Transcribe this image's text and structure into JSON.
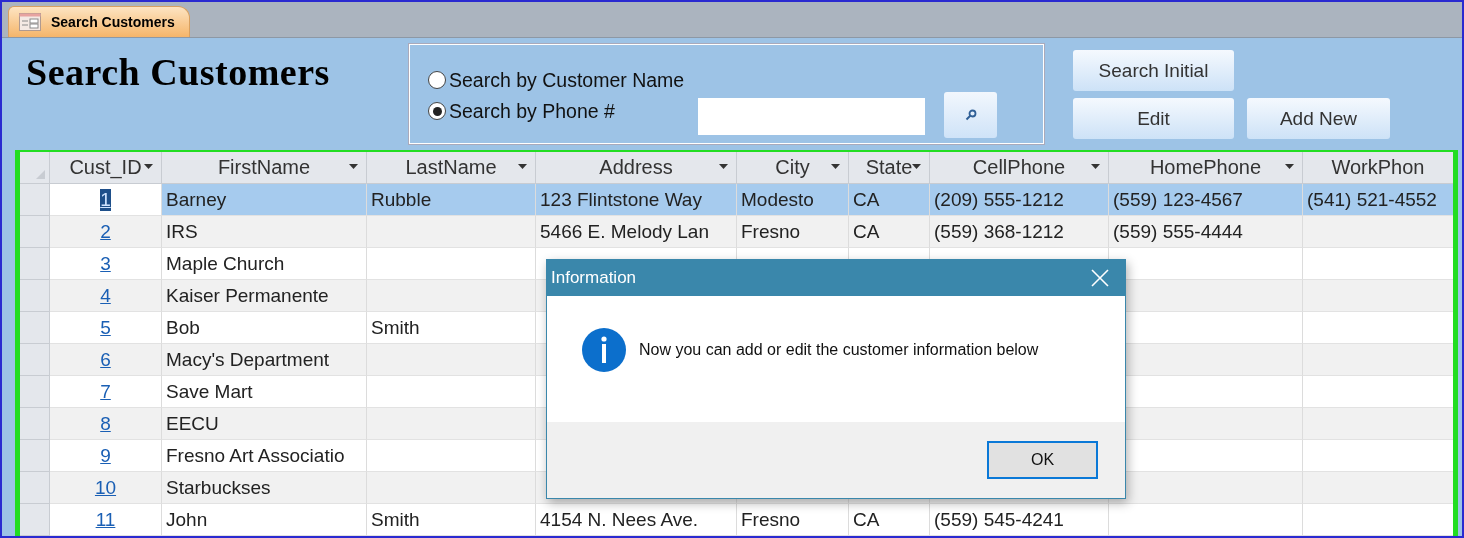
{
  "tab": {
    "label": "Search Customers"
  },
  "form": {
    "title": "Search Customers",
    "search_options": [
      {
        "label": "Search by Customer Name",
        "selected": false
      },
      {
        "label": "Search by Phone #",
        "selected": true
      }
    ],
    "buttons": [
      "Search Initial",
      "Edit",
      "Add New"
    ]
  },
  "table": {
    "columns": [
      {
        "label": "Cust_ID",
        "filter": true
      },
      {
        "label": "FirstName",
        "filter": true
      },
      {
        "label": "LastName",
        "filter": true
      },
      {
        "label": "Address",
        "filter": true
      },
      {
        "label": "City",
        "filter": true
      },
      {
        "label": "State",
        "filter": true
      },
      {
        "label": "CellPhone",
        "filter": true
      },
      {
        "label": "HomePhone",
        "filter": true
      },
      {
        "label": "WorkPhon",
        "filter": false
      }
    ],
    "rows": [
      {
        "selected": true,
        "cells": [
          "1",
          "Barney",
          "Rubble",
          "123 Flintstone Way",
          "Modesto",
          "CA",
          "(209) 555-1212",
          "(559) 123-4567",
          "(541) 521-4552"
        ]
      },
      {
        "selected": false,
        "cells": [
          "2",
          "IRS",
          null,
          "5466 E. Melody Lan",
          "Fresno",
          "CA",
          "(559) 368-1212",
          "(559) 555-4444",
          null
        ]
      },
      {
        "selected": false,
        "cells": [
          "3",
          "Maple Church",
          null,
          null,
          null,
          null,
          null,
          null,
          null
        ]
      },
      {
        "selected": false,
        "cells": [
          "4",
          "Kaiser Permanente",
          null,
          null,
          null,
          null,
          null,
          null,
          null
        ]
      },
      {
        "selected": false,
        "cells": [
          "5",
          "Bob",
          "Smith",
          null,
          null,
          null,
          null,
          null,
          null
        ]
      },
      {
        "selected": false,
        "cells": [
          "6",
          "Macy's Department",
          null,
          null,
          null,
          null,
          null,
          null,
          null
        ]
      },
      {
        "selected": false,
        "cells": [
          "7",
          "Save Mart",
          null,
          null,
          null,
          null,
          null,
          null,
          null
        ]
      },
      {
        "selected": false,
        "cells": [
          "8",
          "EECU",
          null,
          null,
          null,
          null,
          null,
          null,
          null
        ]
      },
      {
        "selected": false,
        "cells": [
          "9",
          "Fresno Art Associatio",
          null,
          null,
          null,
          null,
          null,
          null,
          null
        ]
      },
      {
        "selected": false,
        "cells": [
          "10",
          "Starbuckses",
          null,
          null,
          null,
          null,
          null,
          null,
          null
        ]
      },
      {
        "selected": false,
        "cells": [
          "11",
          "John",
          "Smith",
          "4154 N. Nees Ave.",
          "Fresno",
          "CA",
          "(559) 545-4241",
          null,
          null
        ]
      }
    ]
  },
  "dialog": {
    "title": "Information",
    "message": "Now you can add or edit the customer information below",
    "button": "OK"
  }
}
